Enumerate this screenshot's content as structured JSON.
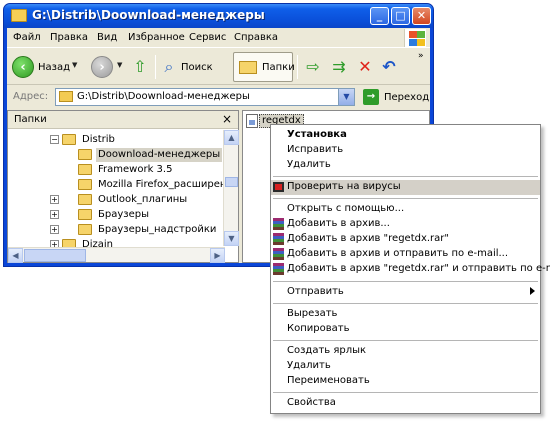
{
  "window": {
    "title": "G:\\Distrib\\Doownload-менеджеры",
    "menu": [
      "Файл",
      "Правка",
      "Вид",
      "Избранное",
      "Сервис",
      "Справка"
    ],
    "toolbar": {
      "back_label": "Назад",
      "search_label": "Поиск",
      "folders_label": "Папки"
    },
    "address": {
      "label": "Адрес:",
      "value": "G:\\Distrib\\Doownload-менеджеры",
      "go_label": "Переход"
    },
    "folders_pane": {
      "header": "Папки",
      "tree": [
        "Distrib",
        "Doownload-менеджеры",
        "Framework 3.5",
        "Mozilla Firefox_расширения",
        "Outlook_плагины",
        "Браузеры",
        "Браузеры_надстройки",
        "Dizain"
      ]
    },
    "file": {
      "name": "regetdx"
    }
  },
  "context_menu": {
    "items": [
      "Установка",
      "Исправить",
      "Удалить",
      "Проверить на вирусы",
      "Открыть с помощью...",
      "Добавить в архив...",
      "Добавить в архив \"regetdx.rar\"",
      "Добавить в архив и отправить по e-mail...",
      "Добавить в архив \"regetdx.rar\" и отправить по e-mail",
      "Отправить",
      "Вырезать",
      "Копировать",
      "Создать ярлык",
      "Удалить",
      "Переименовать",
      "Свойства"
    ]
  },
  "colors": {
    "titlebar": "#0a4fd9",
    "face": "#ece9d8",
    "highlight": "#d4d0c8"
  }
}
